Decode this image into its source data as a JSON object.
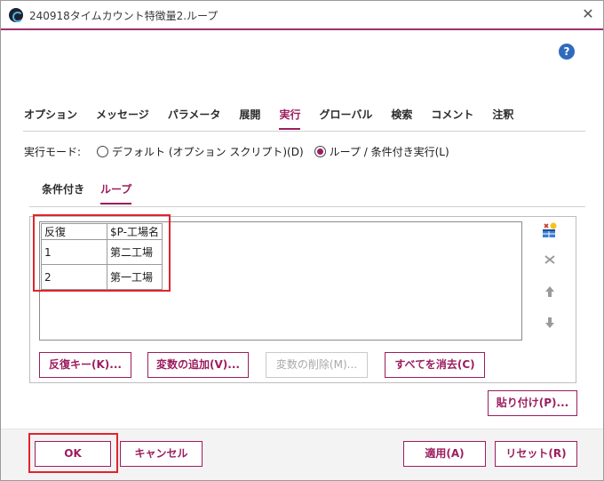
{
  "window": {
    "title": "240918タイムカウント特徴量2.ループ"
  },
  "tabs": [
    {
      "label": "オプション"
    },
    {
      "label": "メッセージ"
    },
    {
      "label": "パラメータ"
    },
    {
      "label": "展開"
    },
    {
      "label": "実行"
    },
    {
      "label": "グローバル"
    },
    {
      "label": "検索"
    },
    {
      "label": "コメント"
    },
    {
      "label": "注釈"
    }
  ],
  "mode": {
    "label": "実行モード:",
    "option_default": "デフォルト (オプション スクリプト)(D)",
    "option_loop": "ループ / 条件付き実行(L)",
    "selected": "loop"
  },
  "subtabs": [
    {
      "label": "条件付き"
    },
    {
      "label": "ループ"
    }
  ],
  "table": {
    "headers": [
      "反復",
      "$P-工場名"
    ],
    "rows": [
      [
        "1",
        "第二工場"
      ],
      [
        "2",
        "第一工場"
      ]
    ]
  },
  "buttons": {
    "iterate_key": "反復キー(K)...",
    "add_variable": "変数の追加(V)...",
    "delete_variable": "変数の削除(M)...",
    "clear_all": "すべてを消去(C)",
    "paste": "貼り付け(P)...",
    "ok": "OK",
    "cancel": "キャンセル",
    "apply": "適用(A)",
    "reset": "リセット(R)"
  },
  "icons": {
    "help": "?",
    "close": "✕"
  },
  "colors": {
    "accent": "#9c1d5e",
    "highlight": "#e0242c"
  }
}
